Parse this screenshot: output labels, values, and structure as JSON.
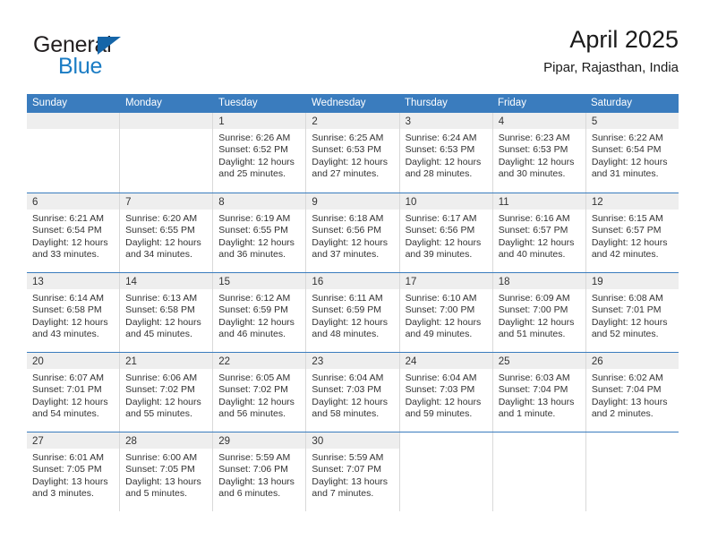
{
  "brand": {
    "name_part1": "General",
    "name_part2": "Blue",
    "triangle_color": "#1565a8",
    "blue_color": "#1a7cc4"
  },
  "header": {
    "title": "April 2025",
    "subtitle": "Pipar, Rajasthan, India"
  },
  "theme": {
    "header_bar_color": "#3a7cbe",
    "day_band_color": "#eeeeee",
    "grid_line_color": "#d9d9d9",
    "text_color": "#333333"
  },
  "weekdays": [
    "Sunday",
    "Monday",
    "Tuesday",
    "Wednesday",
    "Thursday",
    "Friday",
    "Saturday"
  ],
  "weeks": [
    [
      {
        "day": "",
        "empty": true
      },
      {
        "day": "",
        "empty": true
      },
      {
        "day": "1",
        "sunrise": "Sunrise: 6:26 AM",
        "sunset": "Sunset: 6:52 PM",
        "daylight1": "Daylight: 12 hours",
        "daylight2": "and 25 minutes."
      },
      {
        "day": "2",
        "sunrise": "Sunrise: 6:25 AM",
        "sunset": "Sunset: 6:53 PM",
        "daylight1": "Daylight: 12 hours",
        "daylight2": "and 27 minutes."
      },
      {
        "day": "3",
        "sunrise": "Sunrise: 6:24 AM",
        "sunset": "Sunset: 6:53 PM",
        "daylight1": "Daylight: 12 hours",
        "daylight2": "and 28 minutes."
      },
      {
        "day": "4",
        "sunrise": "Sunrise: 6:23 AM",
        "sunset": "Sunset: 6:53 PM",
        "daylight1": "Daylight: 12 hours",
        "daylight2": "and 30 minutes."
      },
      {
        "day": "5",
        "sunrise": "Sunrise: 6:22 AM",
        "sunset": "Sunset: 6:54 PM",
        "daylight1": "Daylight: 12 hours",
        "daylight2": "and 31 minutes."
      }
    ],
    [
      {
        "day": "6",
        "sunrise": "Sunrise: 6:21 AM",
        "sunset": "Sunset: 6:54 PM",
        "daylight1": "Daylight: 12 hours",
        "daylight2": "and 33 minutes."
      },
      {
        "day": "7",
        "sunrise": "Sunrise: 6:20 AM",
        "sunset": "Sunset: 6:55 PM",
        "daylight1": "Daylight: 12 hours",
        "daylight2": "and 34 minutes."
      },
      {
        "day": "8",
        "sunrise": "Sunrise: 6:19 AM",
        "sunset": "Sunset: 6:55 PM",
        "daylight1": "Daylight: 12 hours",
        "daylight2": "and 36 minutes."
      },
      {
        "day": "9",
        "sunrise": "Sunrise: 6:18 AM",
        "sunset": "Sunset: 6:56 PM",
        "daylight1": "Daylight: 12 hours",
        "daylight2": "and 37 minutes."
      },
      {
        "day": "10",
        "sunrise": "Sunrise: 6:17 AM",
        "sunset": "Sunset: 6:56 PM",
        "daylight1": "Daylight: 12 hours",
        "daylight2": "and 39 minutes."
      },
      {
        "day": "11",
        "sunrise": "Sunrise: 6:16 AM",
        "sunset": "Sunset: 6:57 PM",
        "daylight1": "Daylight: 12 hours",
        "daylight2": "and 40 minutes."
      },
      {
        "day": "12",
        "sunrise": "Sunrise: 6:15 AM",
        "sunset": "Sunset: 6:57 PM",
        "daylight1": "Daylight: 12 hours",
        "daylight2": "and 42 minutes."
      }
    ],
    [
      {
        "day": "13",
        "sunrise": "Sunrise: 6:14 AM",
        "sunset": "Sunset: 6:58 PM",
        "daylight1": "Daylight: 12 hours",
        "daylight2": "and 43 minutes."
      },
      {
        "day": "14",
        "sunrise": "Sunrise: 6:13 AM",
        "sunset": "Sunset: 6:58 PM",
        "daylight1": "Daylight: 12 hours",
        "daylight2": "and 45 minutes."
      },
      {
        "day": "15",
        "sunrise": "Sunrise: 6:12 AM",
        "sunset": "Sunset: 6:59 PM",
        "daylight1": "Daylight: 12 hours",
        "daylight2": "and 46 minutes."
      },
      {
        "day": "16",
        "sunrise": "Sunrise: 6:11 AM",
        "sunset": "Sunset: 6:59 PM",
        "daylight1": "Daylight: 12 hours",
        "daylight2": "and 48 minutes."
      },
      {
        "day": "17",
        "sunrise": "Sunrise: 6:10 AM",
        "sunset": "Sunset: 7:00 PM",
        "daylight1": "Daylight: 12 hours",
        "daylight2": "and 49 minutes."
      },
      {
        "day": "18",
        "sunrise": "Sunrise: 6:09 AM",
        "sunset": "Sunset: 7:00 PM",
        "daylight1": "Daylight: 12 hours",
        "daylight2": "and 51 minutes."
      },
      {
        "day": "19",
        "sunrise": "Sunrise: 6:08 AM",
        "sunset": "Sunset: 7:01 PM",
        "daylight1": "Daylight: 12 hours",
        "daylight2": "and 52 minutes."
      }
    ],
    [
      {
        "day": "20",
        "sunrise": "Sunrise: 6:07 AM",
        "sunset": "Sunset: 7:01 PM",
        "daylight1": "Daylight: 12 hours",
        "daylight2": "and 54 minutes."
      },
      {
        "day": "21",
        "sunrise": "Sunrise: 6:06 AM",
        "sunset": "Sunset: 7:02 PM",
        "daylight1": "Daylight: 12 hours",
        "daylight2": "and 55 minutes."
      },
      {
        "day": "22",
        "sunrise": "Sunrise: 6:05 AM",
        "sunset": "Sunset: 7:02 PM",
        "daylight1": "Daylight: 12 hours",
        "daylight2": "and 56 minutes."
      },
      {
        "day": "23",
        "sunrise": "Sunrise: 6:04 AM",
        "sunset": "Sunset: 7:03 PM",
        "daylight1": "Daylight: 12 hours",
        "daylight2": "and 58 minutes."
      },
      {
        "day": "24",
        "sunrise": "Sunrise: 6:04 AM",
        "sunset": "Sunset: 7:03 PM",
        "daylight1": "Daylight: 12 hours",
        "daylight2": "and 59 minutes."
      },
      {
        "day": "25",
        "sunrise": "Sunrise: 6:03 AM",
        "sunset": "Sunset: 7:04 PM",
        "daylight1": "Daylight: 13 hours",
        "daylight2": "and 1 minute."
      },
      {
        "day": "26",
        "sunrise": "Sunrise: 6:02 AM",
        "sunset": "Sunset: 7:04 PM",
        "daylight1": "Daylight: 13 hours",
        "daylight2": "and 2 minutes."
      }
    ],
    [
      {
        "day": "27",
        "sunrise": "Sunrise: 6:01 AM",
        "sunset": "Sunset: 7:05 PM",
        "daylight1": "Daylight: 13 hours",
        "daylight2": "and 3 minutes."
      },
      {
        "day": "28",
        "sunrise": "Sunrise: 6:00 AM",
        "sunset": "Sunset: 7:05 PM",
        "daylight1": "Daylight: 13 hours",
        "daylight2": "and 5 minutes."
      },
      {
        "day": "29",
        "sunrise": "Sunrise: 5:59 AM",
        "sunset": "Sunset: 7:06 PM",
        "daylight1": "Daylight: 13 hours",
        "daylight2": "and 6 minutes."
      },
      {
        "day": "30",
        "sunrise": "Sunrise: 5:59 AM",
        "sunset": "Sunset: 7:07 PM",
        "daylight1": "Daylight: 13 hours",
        "daylight2": "and 7 minutes."
      },
      {
        "day": "",
        "empty": true,
        "blank": true
      },
      {
        "day": "",
        "empty": true,
        "blank": true
      },
      {
        "day": "",
        "empty": true,
        "blank": true
      }
    ]
  ]
}
